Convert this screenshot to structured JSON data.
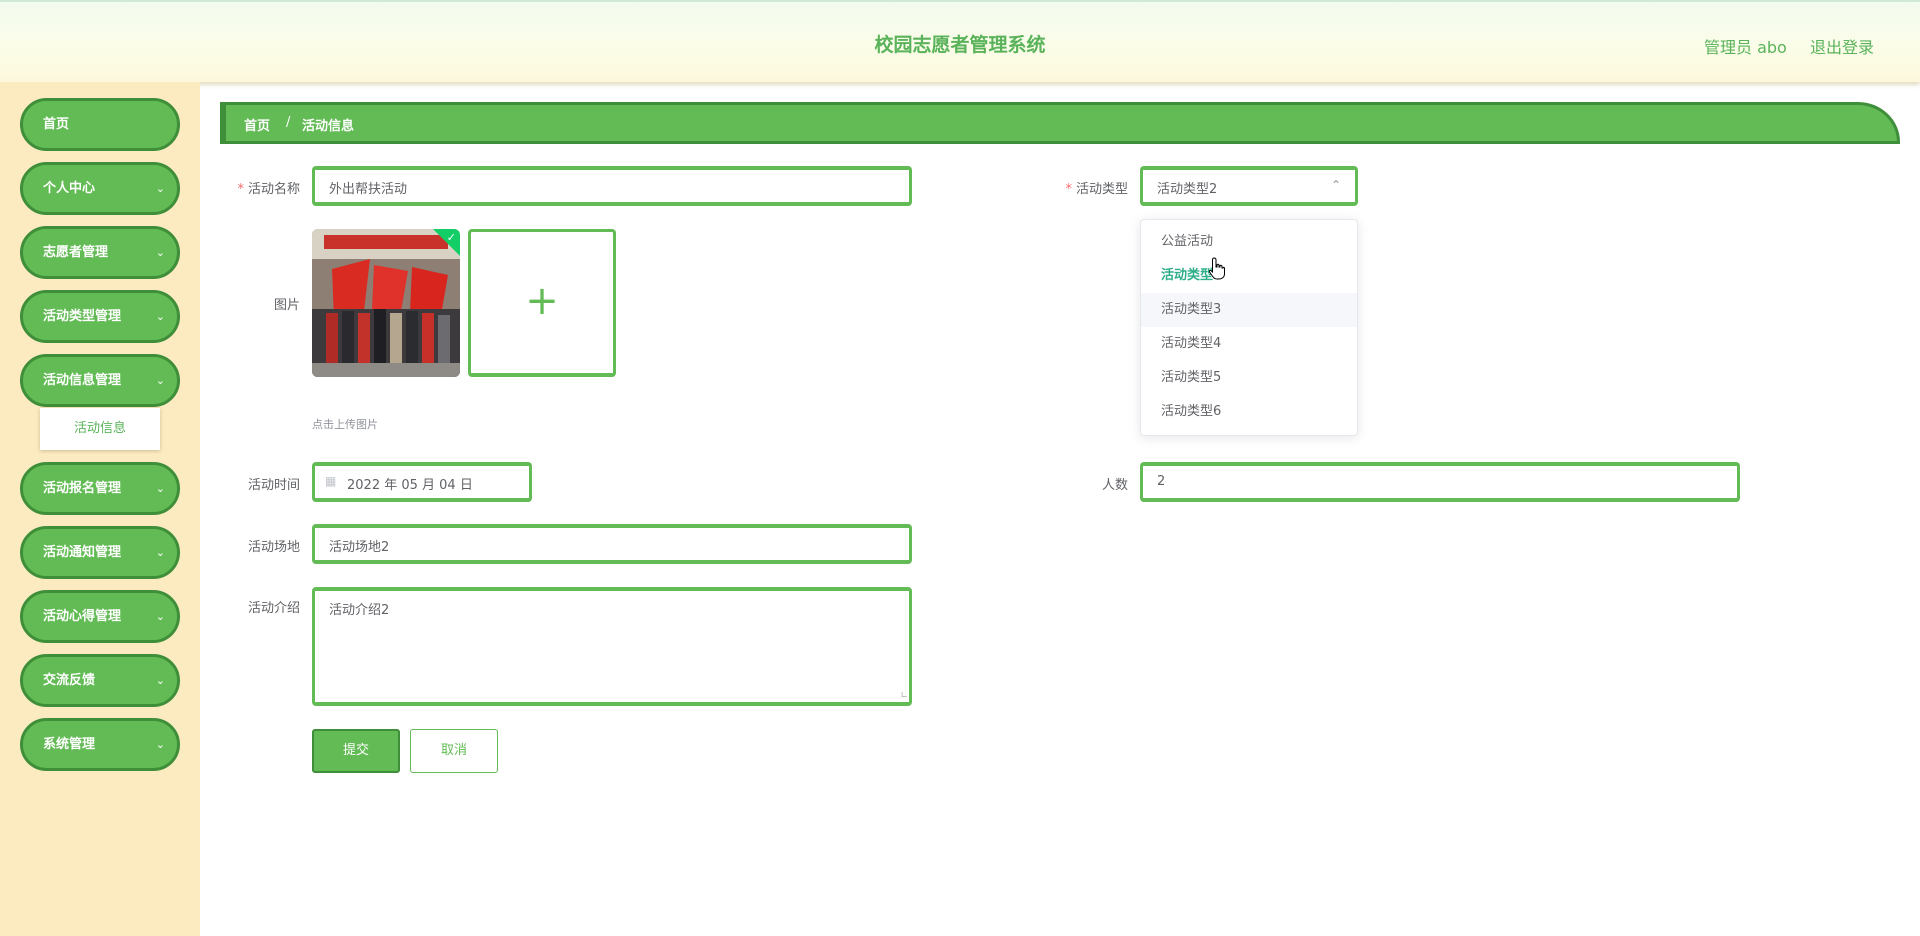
{
  "header": {
    "title": "校园志愿者管理系统",
    "user": "管理员 abo",
    "logout": "退出登录"
  },
  "sidebar": {
    "items": [
      {
        "label": "首页",
        "chevron": false
      },
      {
        "label": "个人中心",
        "chevron": true
      },
      {
        "label": "志愿者管理",
        "chevron": true
      },
      {
        "label": "活动类型管理",
        "chevron": true
      },
      {
        "label": "活动信息管理",
        "chevron": true
      },
      {
        "label": "活动报名管理",
        "chevron": true
      },
      {
        "label": "活动通知管理",
        "chevron": true
      },
      {
        "label": "活动心得管理",
        "chevron": true
      },
      {
        "label": "交流反馈",
        "chevron": true
      },
      {
        "label": "系统管理",
        "chevron": true
      }
    ],
    "submenu": "活动信息"
  },
  "breadcrumb": {
    "home": "首页",
    "separator": "/",
    "current": "活动信息"
  },
  "form": {
    "name_label": "活动名称",
    "name_value": "外出帮扶活动",
    "type_label": "活动类型",
    "type_value": "活动类型2",
    "image_label": "图片",
    "upload_hint": "点击上传图片",
    "time_label": "活动时间",
    "time_value": "2022 年 05 月 04 日",
    "count_label": "人数",
    "count_value": "2",
    "venue_label": "活动场地",
    "venue_value": "活动场地2",
    "intro_label": "活动介绍",
    "intro_value": "活动介绍2",
    "submit": "提交",
    "cancel": "取消",
    "required_mark": "*"
  },
  "dropdown": {
    "options": [
      "公益活动",
      "活动类型2",
      "活动类型3",
      "活动类型4",
      "活动类型5",
      "活动类型6"
    ],
    "selected_index": 1,
    "hover_index": 2
  },
  "colors": {
    "accent": "#62bb54",
    "accent_dark": "#3f8e3a",
    "sidebar_bg": "#fcebc0",
    "selected_text": "#2fae8a"
  }
}
